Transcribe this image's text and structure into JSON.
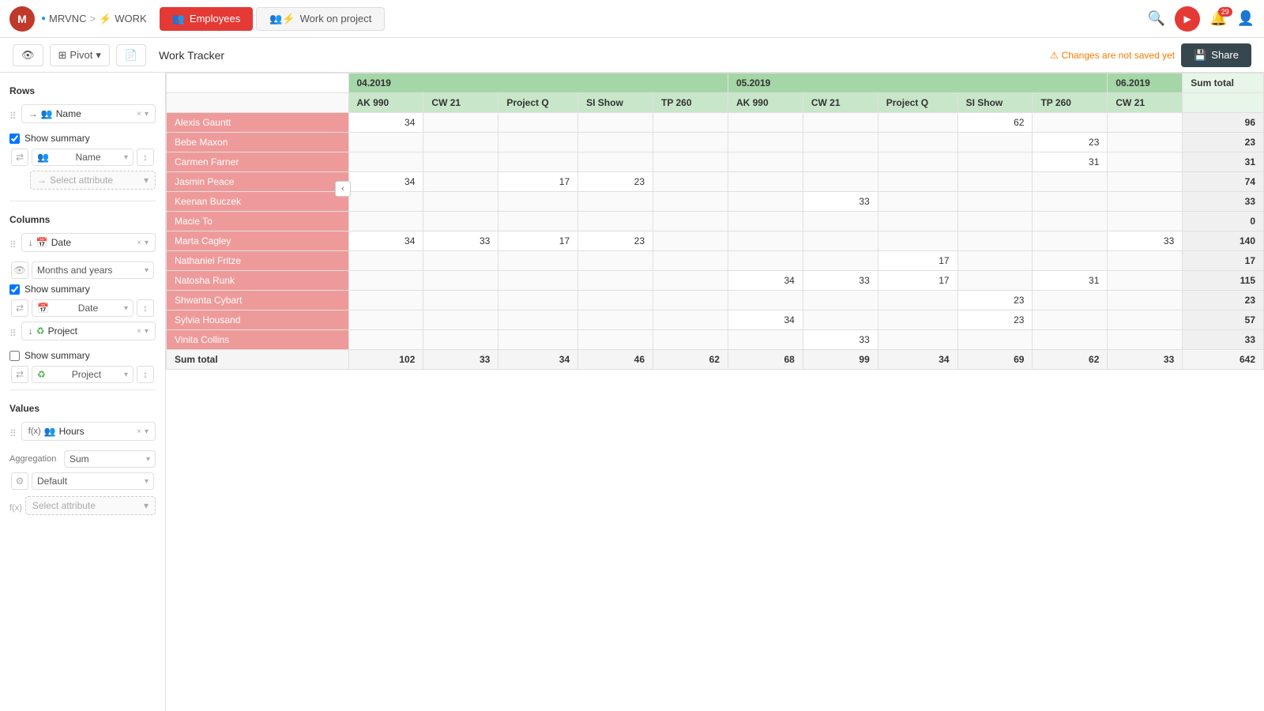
{
  "app": {
    "avatar_text": "M",
    "breadcrumb": {
      "workspace": "MRVNC",
      "separator": ">",
      "project": "WORK"
    }
  },
  "tabs": [
    {
      "id": "employees",
      "label": "Employees",
      "active": true
    },
    {
      "id": "work_on_project",
      "label": "Work on project",
      "active": false
    }
  ],
  "toolbar": {
    "pivot_label": "Pivot",
    "title": "Work Tracker",
    "share_label": "Share",
    "changes_warning": "Changes are not saved yet"
  },
  "left_panel": {
    "rows_section": "Rows",
    "columns_section": "Columns",
    "values_section": "Values",
    "rows": {
      "arrow_item": {
        "label": "Name"
      },
      "show_summary_checked": true,
      "show_summary_label": "Show summary",
      "sub_select": "Name",
      "select_attr_placeholder": "Select attribute"
    },
    "columns": {
      "item_label": "Date",
      "display_label": "Months and years",
      "show_summary_checked": true,
      "show_summary_label": "Show summary",
      "sub_select": "Date"
    },
    "columns2": {
      "item_label": "Project",
      "show_summary_checked": false,
      "show_summary_label": "Show summary",
      "sub_select": "Project"
    },
    "values": {
      "item_label": "Hours",
      "aggregation_label": "Aggregation",
      "aggregation_value": "Sum",
      "display_label": "Default",
      "select_attr_placeholder": "Select attribute"
    }
  },
  "pivot": {
    "months": [
      {
        "label": "04.2019",
        "colspan": 5
      },
      {
        "label": "05.2019",
        "colspan": 5
      },
      {
        "label": "06.2019",
        "colspan": 1
      }
    ],
    "projects": [
      "AK 990",
      "CW 21",
      "Project Q",
      "SI Show",
      "TP 260",
      "AK 990",
      "CW 21",
      "Project Q",
      "SI Show",
      "TP 260",
      "CW 21"
    ],
    "sum_total_header": "Sum total",
    "rows": [
      {
        "name": "Alexis Gauntt",
        "values": [
          34,
          null,
          null,
          null,
          null,
          null,
          null,
          null,
          62,
          null,
          null
        ],
        "total": 96
      },
      {
        "name": "Bebe Maxon",
        "values": [
          null,
          null,
          null,
          null,
          null,
          null,
          null,
          null,
          null,
          23,
          null
        ],
        "total": 23
      },
      {
        "name": "Carmen Farner",
        "values": [
          null,
          null,
          null,
          null,
          null,
          null,
          null,
          null,
          null,
          31,
          null
        ],
        "total": 31
      },
      {
        "name": "Jasmin Peace",
        "values": [
          34,
          null,
          17,
          23,
          null,
          null,
          null,
          null,
          null,
          null,
          null
        ],
        "total": 74
      },
      {
        "name": "Keenan Buczek",
        "values": [
          null,
          null,
          null,
          null,
          null,
          null,
          33,
          null,
          null,
          null,
          null
        ],
        "total": 33
      },
      {
        "name": "Macie To",
        "values": [
          null,
          null,
          null,
          null,
          null,
          null,
          null,
          null,
          null,
          null,
          null
        ],
        "total": 0
      },
      {
        "name": "Marta Cagley",
        "values": [
          34,
          33,
          17,
          23,
          null,
          null,
          null,
          null,
          null,
          null,
          33
        ],
        "total": 140
      },
      {
        "name": "Nathaniel Fritze",
        "values": [
          null,
          null,
          null,
          null,
          null,
          null,
          null,
          17,
          null,
          null,
          null
        ],
        "total": 17
      },
      {
        "name": "Natosha Runk",
        "values": [
          null,
          null,
          null,
          null,
          null,
          34,
          33,
          17,
          null,
          31,
          null
        ],
        "total": 115
      },
      {
        "name": "Shwanta Cybart",
        "values": [
          null,
          null,
          null,
          null,
          null,
          null,
          null,
          null,
          23,
          null,
          null
        ],
        "total": 23
      },
      {
        "name": "Sylvia Housand",
        "values": [
          null,
          null,
          null,
          null,
          null,
          34,
          null,
          null,
          23,
          null,
          null
        ],
        "total": 57
      },
      {
        "name": "Vinita Collins",
        "values": [
          null,
          null,
          null,
          null,
          null,
          null,
          33,
          null,
          null,
          null,
          null
        ],
        "total": 33
      }
    ],
    "sum_row": {
      "label": "Sum total",
      "values": [
        102,
        33,
        34,
        46,
        62,
        68,
        99,
        34,
        69,
        62,
        33
      ],
      "total": 642
    }
  },
  "icons": {
    "search": "🔍",
    "bell": "🔔",
    "user": "👤",
    "youtube": "▶",
    "pivot": "⊞",
    "share": "💾",
    "eye": "👁",
    "doc": "📄",
    "drag": "⠿",
    "chevron_down": "▾",
    "chevron_left": "‹",
    "sort_asc": "↕",
    "employees_icon": "👥",
    "work_icon": "⚡",
    "close": "×",
    "warning": "⚠"
  },
  "colors": {
    "tab_active_bg": "#e53935",
    "row_name_bg": "#ef9a9a",
    "month_header_bg": "#a5d6a7",
    "project_header_bg": "#c8e6c9"
  },
  "notification_count": "29"
}
